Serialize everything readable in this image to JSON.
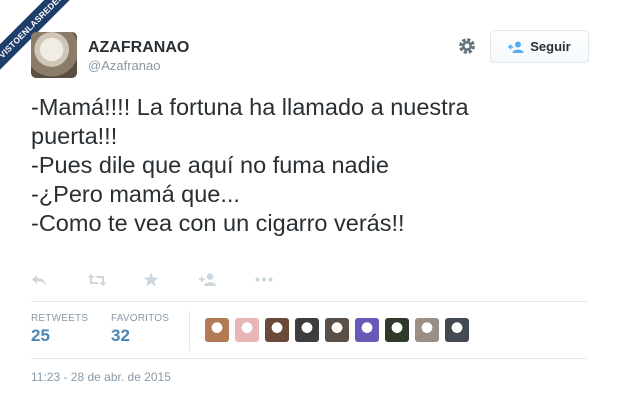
{
  "watermark": "VISTOENLASREDES",
  "author": {
    "name": "AZAFRANAO",
    "handle": "@Azafranao"
  },
  "follow_button": {
    "label": "Seguir"
  },
  "tweet": {
    "text": "-Mamá!!!! La fortuna ha llamado a nuestra\npuerta!!!\n-Pues dile que aquí no fuma nadie\n-¿Pero mamá que...\n-Como te vea con un cigarro verás!!"
  },
  "stats": {
    "retweets": {
      "label": "RETWEETS",
      "value": "25"
    },
    "favorites": {
      "label": "FAVORITOS",
      "value": "32"
    }
  },
  "favoriter_avatar_colors": [
    "#b27a55",
    "#e8b6b6",
    "#6b4a3a",
    "#3d3d3d",
    "#5a5048",
    "#6a5ab8",
    "#2f3a2a",
    "#9a8f86",
    "#444a52"
  ],
  "timestamp": "11:23 - 28 de abr. de 2015",
  "icons": [
    "reply-icon",
    "retweet-icon",
    "favorite-icon",
    "follow-icon",
    "more-icon",
    "gear-icon"
  ]
}
